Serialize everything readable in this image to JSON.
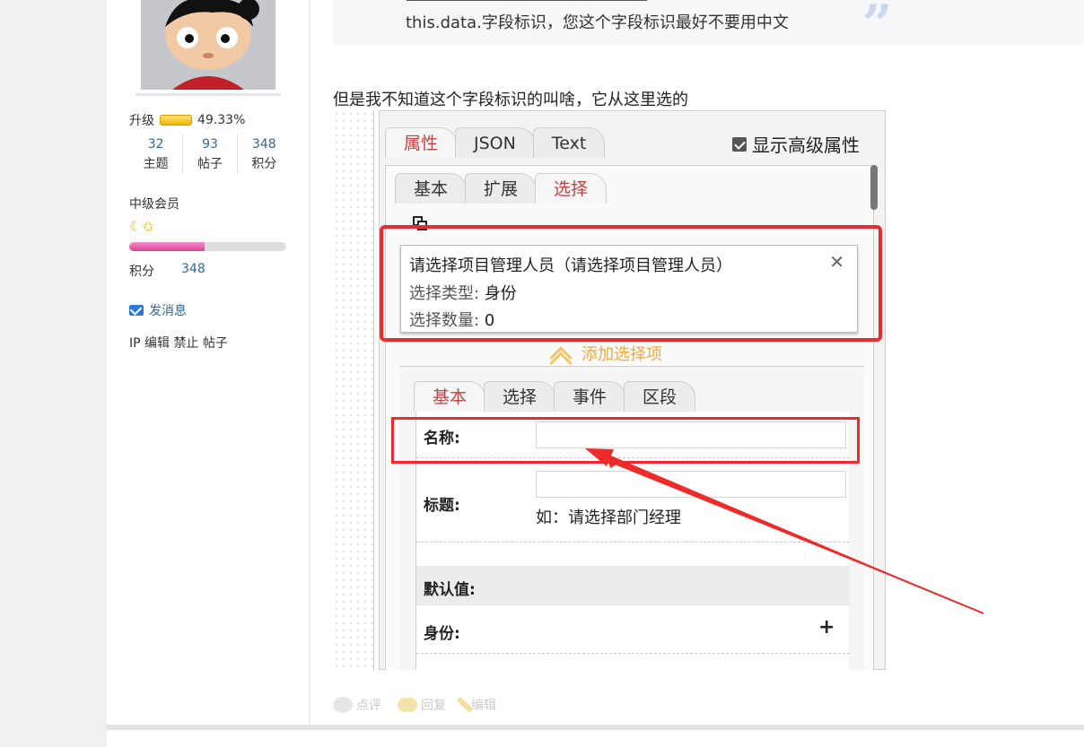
{
  "user": {
    "level_label": "升级",
    "level_percent_text": "49.33%",
    "level_progress": 0.4933,
    "stats": [
      {
        "num": "32",
        "label": "主题"
      },
      {
        "num": "93",
        "label": "帖子"
      },
      {
        "num": "348",
        "label": "积分"
      }
    ],
    "grade": "中级会员",
    "grade_progress": 0.48,
    "score_label": "积分",
    "score_value": "348",
    "send_message": "发消息",
    "admin_links": "IP 编辑 禁止 帖子"
  },
  "post": {
    "quote_text": "this.data.字段标识，您这个字段标识最好不要用中文",
    "paragraph": "但是我不知道这个字段标识的叫啥，它从这里选的"
  },
  "screenshot": {
    "top_tabs": [
      "属性",
      "JSON",
      "Text"
    ],
    "show_advanced": "显示高级属性",
    "mid_tabs": [
      "基本",
      "扩展",
      "选择"
    ],
    "selection_card": {
      "title": "请选择项目管理人员（请选择项目管理人员）",
      "type_label": "选择类型:",
      "type_value": "身份",
      "count_label": "选择数量:",
      "count_value": "0"
    },
    "add_item": "添加选择项",
    "low_tabs": [
      "基本",
      "选择",
      "事件",
      "区段"
    ],
    "form": {
      "name_label": "名称:",
      "title_label": "标题:",
      "title_hint": "如：请选择部门经理",
      "default_label": "默认值:",
      "identity_label": "身份:"
    }
  },
  "actions": {
    "comment": "点评",
    "reply": "回复",
    "edit": "编辑"
  }
}
